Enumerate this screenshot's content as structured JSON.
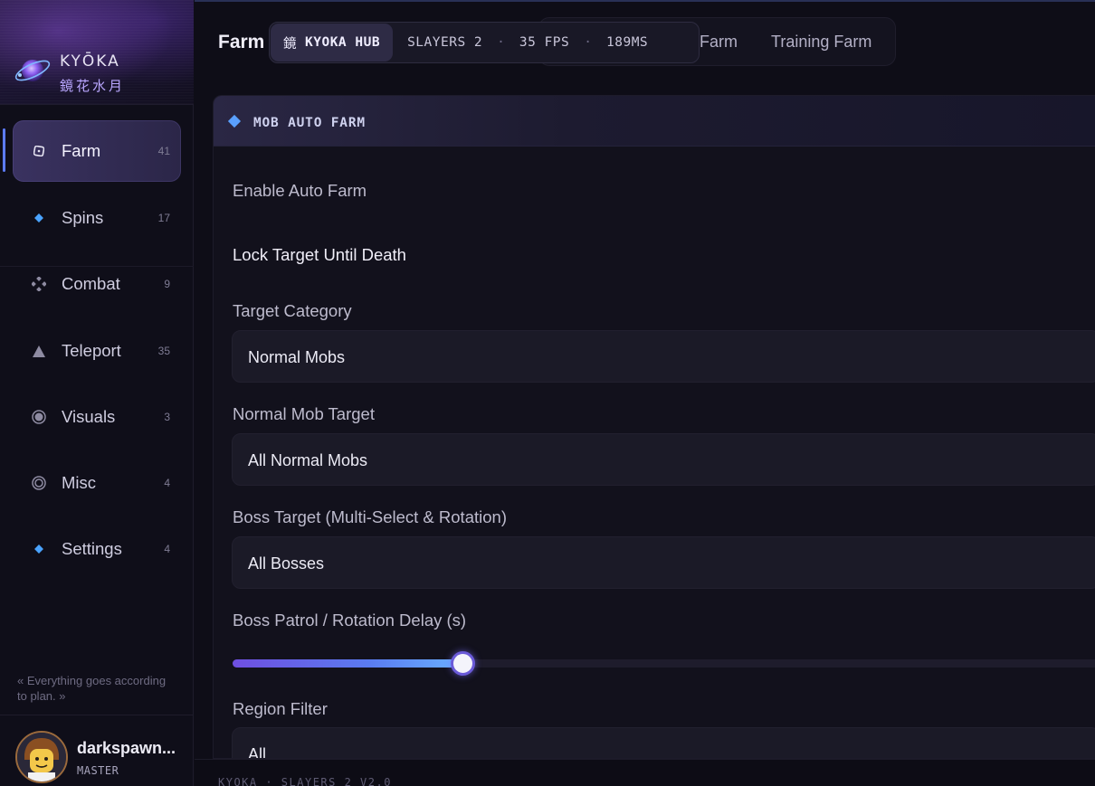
{
  "brand": {
    "name": "KYŌKA",
    "subtitle": "鏡花水月"
  },
  "sidebar": {
    "items": [
      {
        "label": "Farm",
        "count": "41",
        "icon": "dice-icon",
        "active": true
      },
      {
        "label": "Spins",
        "count": "17",
        "icon": "diamond-icon",
        "active": false
      },
      {
        "label": "Combat",
        "count": "9",
        "icon": "crosshair-icon",
        "active": false
      },
      {
        "label": "Teleport",
        "count": "35",
        "icon": "triangle-icon",
        "active": false
      },
      {
        "label": "Visuals",
        "count": "3",
        "icon": "eye-icon",
        "active": false
      },
      {
        "label": "Misc",
        "count": "4",
        "icon": "ring-icon",
        "active": false
      },
      {
        "label": "Settings",
        "count": "4",
        "icon": "diamond-icon",
        "active": false
      }
    ],
    "quote": "« Everything goes according to plan. »",
    "user": {
      "name": "darkspawn...",
      "role": "MASTER"
    }
  },
  "header": {
    "title": "Farm",
    "tabs": [
      {
        "label": "Farm"
      },
      {
        "label": "Training Farm"
      }
    ],
    "hud": {
      "kanji": "鏡",
      "brand": "KYOKA HUB",
      "game": "SLAYERS 2",
      "fps": "35 FPS",
      "ping": "189MS",
      "separator": "·"
    }
  },
  "section": {
    "title": "MOB AUTO FARM",
    "enable_auto_farm_label": "Enable Auto Farm",
    "lock_target_label": "Lock Target Until Death",
    "target_category": {
      "label": "Target Category",
      "value": "Normal Mobs"
    },
    "normal_mob_target": {
      "label": "Normal Mob Target",
      "value": "All Normal Mobs"
    },
    "boss_target": {
      "label": "Boss Target (Multi-Select & Rotation)",
      "value": "All Bosses"
    },
    "boss_delay": {
      "label": "Boss Patrol / Rotation Delay (s)",
      "fill_fraction": 0.265
    },
    "region_filter": {
      "label": "Region Filter",
      "value": "All"
    }
  },
  "footer": {
    "text": "KYOKA · SLAYERS 2 V2.0"
  },
  "colors": {
    "accent": "#5d7cff",
    "diamond": "#5aa0ff",
    "panel": "#12111c"
  }
}
